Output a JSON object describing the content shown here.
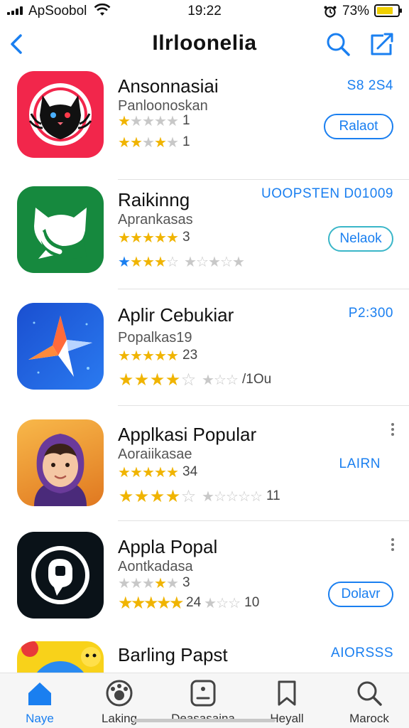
{
  "status_bar": {
    "carrier": "ApSoobol",
    "time": "19:22",
    "battery": "73%"
  },
  "nav": {
    "title": "Ilrloonelia"
  },
  "apps": [
    {
      "name": "Ansonnasiai",
      "subtitle": "Panloonoskan",
      "rating1": "1",
      "rating2": "1",
      "price": "S8 2S4",
      "button": "Ralaot",
      "icon": "cat-logo-red"
    },
    {
      "name": "Raikinng",
      "subtitle": "Aprankasas",
      "rating1": "3",
      "rating2": "",
      "price": "UOOPSTEN D01009",
      "button": "Nelaok",
      "icon": "cat-logo-green"
    },
    {
      "name": "Aplir Cebukiar",
      "subtitle": "Popalkas19",
      "rating1": "23",
      "rating2": "/1Ou",
      "price": "P2:300",
      "icon": "star-logo-blue"
    },
    {
      "name": "Applkasi Popular",
      "subtitle": "Aoraiikasae",
      "rating1": "34",
      "rating2": "11",
      "price": "LAIRN",
      "icon": "girl-avatar"
    },
    {
      "name": "Appla Popal",
      "subtitle": "Aontkadasa",
      "rating1": "3",
      "rating2": "24",
      "rating3": "10",
      "button": "Dolavr",
      "icon": "camera-logo-dark"
    },
    {
      "name": "Barling Papst",
      "price": "AIORSSS",
      "icon": "emoji-logo-yellow"
    }
  ],
  "tabs": [
    {
      "label": "Naye",
      "icon": "home-icon",
      "active": true
    },
    {
      "label": "Laking",
      "icon": "games-icon"
    },
    {
      "label": "Deasasaina",
      "icon": "apps-icon"
    },
    {
      "label": "Heyall",
      "icon": "bookmark-icon"
    },
    {
      "label": "Marock",
      "icon": "search-tab-icon"
    }
  ],
  "colors": {
    "accent": "#1a7ff0",
    "star": "#f0b400",
    "star_off": "#c8c8c8",
    "battery": "#f0d000"
  }
}
